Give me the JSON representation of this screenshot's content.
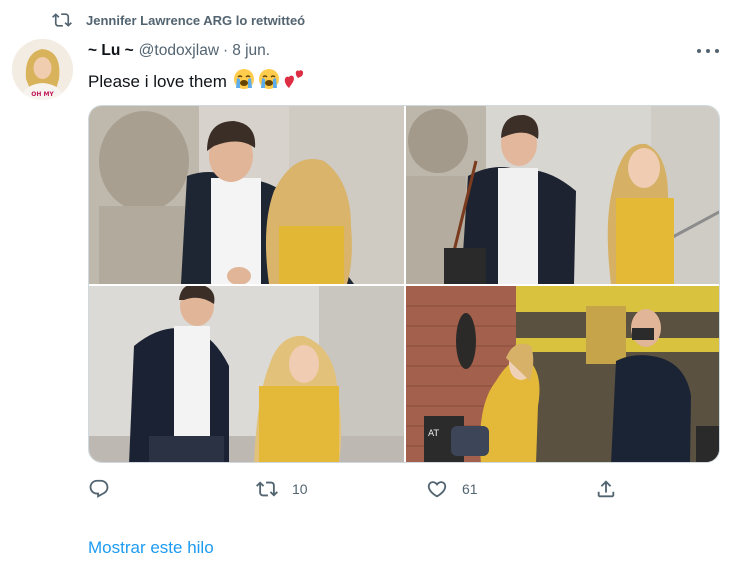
{
  "retweet_context": {
    "text": "Jennifer Lawrence ARG lo retwitteó",
    "icon": "retweet-icon"
  },
  "tweet": {
    "author": {
      "display_name": "~ Lu ~",
      "handle": "@todoxjlaw",
      "avatar_text": "OH MY"
    },
    "separator": "·",
    "date": "8 jun.",
    "text": "Please i love them",
    "emojis": [
      "loudly-crying-face",
      "loudly-crying-face",
      "two-hearts"
    ],
    "media": [
      {
        "name": "photo-1"
      },
      {
        "name": "photo-2"
      },
      {
        "name": "photo-3"
      },
      {
        "name": "photo-4",
        "sign_text": "AT"
      }
    ]
  },
  "actions": {
    "reply": {
      "icon": "reply-icon",
      "count": ""
    },
    "retweet": {
      "icon": "retweet-icon",
      "count": "10"
    },
    "like": {
      "icon": "heart-icon",
      "count": "61"
    },
    "share": {
      "icon": "share-icon",
      "count": ""
    }
  },
  "show_thread": "Mostrar este hilo",
  "colors": {
    "accent": "#1d9bf0",
    "secondary_text": "#536471",
    "primary_text": "#0f1419",
    "border": "#cfd9de"
  }
}
